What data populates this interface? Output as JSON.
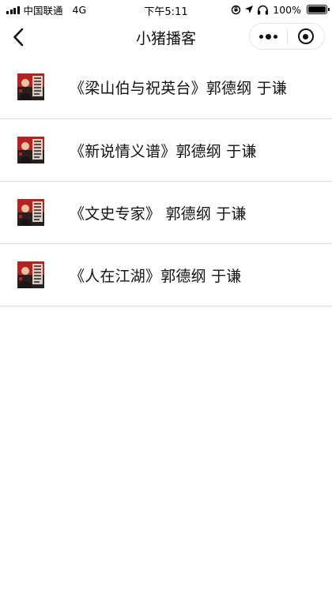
{
  "status_bar": {
    "carrier": "中国联通",
    "network": "4G",
    "time": "下午5:11",
    "battery": "100%",
    "battery_level": 1.0
  },
  "nav": {
    "title": "小猪播客",
    "back_icon": "chevron-left-icon",
    "more_icon": "more-dots-icon",
    "close_icon": "target-circle-icon"
  },
  "episodes": [
    {
      "title": "《梁山伯与祝英台》郭德纲 于谦",
      "thumb_icon": "album-cover-thumbnail"
    },
    {
      "title": "《新说情义谱》郭德纲 于谦",
      "thumb_icon": "album-cover-thumbnail"
    },
    {
      "title": "《文史专家》 郭德纲 于谦",
      "thumb_icon": "album-cover-thumbnail"
    },
    {
      "title": "《人在江湖》郭德纲 于谦",
      "thumb_icon": "album-cover-thumbnail"
    }
  ],
  "colors": {
    "background": "#ffffff",
    "divider": "#dedede",
    "thumb_red": "#b3231f",
    "thumb_dark": "#2a1f1e"
  }
}
